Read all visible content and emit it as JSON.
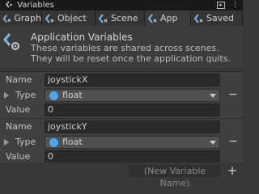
{
  "window": {
    "title": "Variables"
  },
  "tabs": [
    {
      "label": "Graph"
    },
    {
      "label": "Object"
    },
    {
      "label": "Scene"
    },
    {
      "label": "App"
    },
    {
      "label": "Saved"
    }
  ],
  "active_tab": "App",
  "header": {
    "title": "Application Variables",
    "description": "These variables are shared across scenes. They will be reset once the application quits."
  },
  "labels": {
    "name": "Name",
    "type": "Type",
    "value": "Value"
  },
  "variables": [
    {
      "name": "joystickX",
      "type": "float",
      "value": "0"
    },
    {
      "name": "joystickY",
      "type": "float",
      "value": "0"
    }
  ],
  "footer": {
    "new_variable_placeholder": "(New Variable Name)"
  },
  "colors": {
    "type_dot": "#4aa8f0",
    "background": "#383838"
  }
}
